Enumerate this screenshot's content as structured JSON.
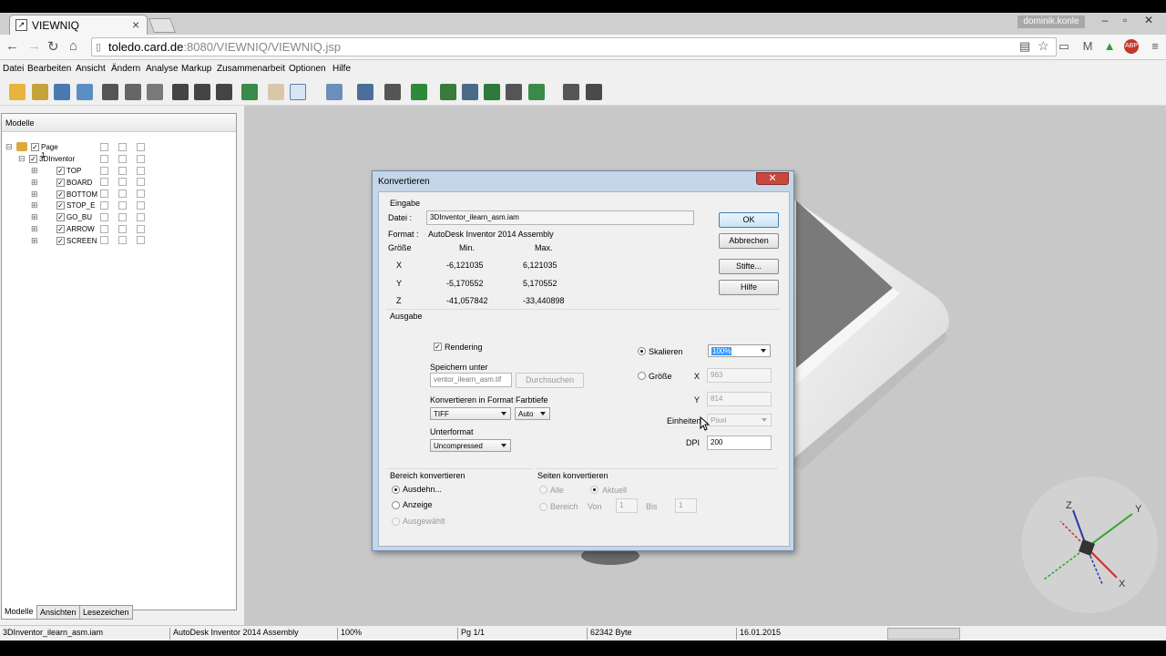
{
  "browser": {
    "tab_title": "VIEWNIQ",
    "url_host": "toledo.card.de",
    "url_rest": ":8080/VIEWNIQ/VIEWNIQ.jsp",
    "user": "dominik.konle"
  },
  "menu": [
    "Datei",
    "Bearbeiten",
    "Ansicht",
    "Ändern",
    "Analyse",
    "Markup",
    "Zusammenarbeit",
    "Optionen",
    "Hilfe"
  ],
  "left_panel": {
    "header": "Modelle",
    "root": "Page 1",
    "model": "3DInventor",
    "items": [
      "TOP",
      "BOARD",
      "BOTTOM",
      "STOP_E",
      "GO_BU",
      "ARROW",
      "SCREEN"
    ],
    "tabs": [
      "Modelle",
      "Ansichten",
      "Lesezeichen"
    ]
  },
  "dialog": {
    "title": "Konvertieren",
    "close": "✕",
    "input": {
      "group": "Eingabe",
      "file_label": "Datei :",
      "file_value": "3DInventor_ilearn_asm.iam",
      "format_label": "Format :",
      "format_value": "AutoDesk Inventor 2014 Assembly",
      "size_label": "Größe",
      "min_label": "Min.",
      "max_label": "Max.",
      "rows": [
        {
          "axis": "X",
          "min": "-6,121035",
          "max": "6,121035"
        },
        {
          "axis": "Y",
          "min": "-5,170552",
          "max": "5,170552"
        },
        {
          "axis": "Z",
          "min": "-41,057842",
          "max": "-33,440898"
        }
      ]
    },
    "buttons": {
      "ok": "OK",
      "cancel": "Abbrechen",
      "pens": "Stifte...",
      "help": "Hilfe"
    },
    "output": {
      "group": "Ausgabe",
      "rendering": "Rendering",
      "save_as_label": "Speichern unter",
      "save_as_value": "ventor_ilearn_asm.tif",
      "browse": "Durchsuchen",
      "format_label": "Konvertieren in Format",
      "format_value": "TIFF",
      "depth_label": "Farbtiefe",
      "depth_value": "Auto",
      "subformat_label": "Unterformat",
      "subformat_value": "Uncompressed",
      "scale_label": "Skalieren",
      "scale_value": "100%",
      "size_label": "Größe",
      "x_label": "X",
      "x_value": "963",
      "y_label": "Y",
      "y_value": "814",
      "units_label": "Einheiten",
      "units_value": "Pixel",
      "dpi_label": "DPI",
      "dpi_value": "200"
    },
    "range": {
      "group": "Bereich konvertieren",
      "options": [
        "Ausdehn...",
        "Anzeige",
        "Ausgewählt"
      ]
    },
    "pages": {
      "group": "Seiten konvertieren",
      "all": "Alle",
      "current": "Aktuell",
      "range": "Bereich",
      "from_label": "Von",
      "from_value": "1",
      "to_label": "Bis",
      "to_value": "1"
    }
  },
  "status": {
    "file": "3DInventor_ilearn_asm.iam",
    "format": "AutoDesk Inventor 2014 Assembly",
    "zoom": "100%",
    "page": "Pg 1/1",
    "bytes": "62342 Byte",
    "date": "16.01.2015"
  },
  "triad": {
    "x": "X",
    "y": "Y",
    "z": "Z"
  }
}
